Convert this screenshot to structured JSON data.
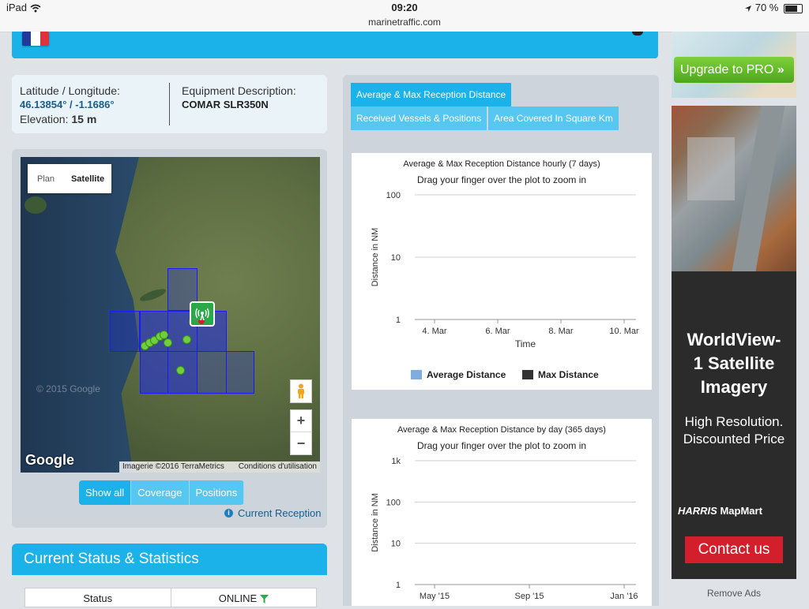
{
  "statusbar": {
    "device": "iPad",
    "time": "09:20",
    "url": "marinetraffic.com",
    "battery": "70 %"
  },
  "colors": {
    "accent": "#1ab2e8",
    "accent_light": "#56c7f0",
    "coverage": "#1a1aff",
    "vessel": "#6fd03b",
    "ad_button": "#d21f2b"
  },
  "info": {
    "latlon_label": "Latitude / Longitude:",
    "latlon_value": "46.13854° / -1.1686°",
    "elevation_label": "Elevation:",
    "elevation_value": "15 m",
    "equipment_label": "Equipment Description:",
    "equipment_value": "COMAR SLR350N"
  },
  "map": {
    "plan_label": "Plan",
    "satellite_label": "Satellite",
    "zoom_in": "+",
    "zoom_out": "−",
    "google_logo": "Google",
    "watermark": "© 2015 Google",
    "attribution": "Imagerie ©2016 TerraMetrics",
    "terms": "Conditions d'utilisation",
    "station_icon": "antenna-icon",
    "pegman_icon": "streetview-pegman-icon"
  },
  "map_filters": {
    "show_all": "Show all",
    "coverage": "Coverage",
    "positions": "Positions"
  },
  "current_reception": "Current Reception",
  "status": {
    "title": "Current Status & Statistics",
    "status_label": "Status",
    "status_value": "ONLINE"
  },
  "tabs": {
    "t1": "Average & Max Reception Distance",
    "t2": "Received Vessels & Positions",
    "t3": "Area Covered In Square Km"
  },
  "chart_data": [
    {
      "type": "area",
      "title": "Average & Max Reception Distance hourly (7 days)",
      "subtitle": "Drag your finger over the plot to zoom in",
      "ylabel": "Distance in NM",
      "xlabel": "Time",
      "yscale": "log",
      "yticks": [
        "1",
        "10",
        "100"
      ],
      "xticks": [
        "4. Mar",
        "6. Mar",
        "8. Mar",
        "10. Mar"
      ],
      "series": [
        {
          "name": "Average Distance",
          "color": "#7eaee0"
        },
        {
          "name": "Max Distance",
          "color": "#333333"
        }
      ]
    },
    {
      "type": "area",
      "title": "Average & Max Reception Distance by day (365 days)",
      "subtitle": "Drag your finger over the plot to zoom in",
      "ylabel": "Distance in NM",
      "yscale": "log",
      "yticks": [
        "1",
        "10",
        "100",
        "1k"
      ],
      "xticks": [
        "May '15",
        "Sep '15",
        "Jan '16"
      ]
    }
  ],
  "ads": {
    "upgrade": "Upgrade to PRO",
    "title1": "WorldView-",
    "title2": "1 Satellite",
    "title3": "Imagery",
    "line1": "High Resolution.",
    "line2": "Discounted Price",
    "brand1": "HARRIS",
    "brand2": "MapMart",
    "contact": "Contact us",
    "remove": "Remove Ads"
  }
}
